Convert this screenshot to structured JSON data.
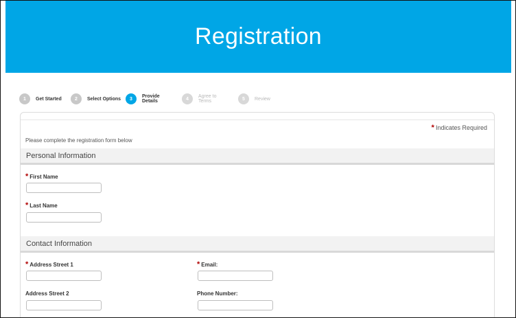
{
  "banner": {
    "title": "Registration"
  },
  "steps": [
    {
      "num": "1",
      "label": "Get Started",
      "state": "done"
    },
    {
      "num": "2",
      "label": "Select Options",
      "state": "done"
    },
    {
      "num": "3",
      "label": "Provide Details",
      "state": "active"
    },
    {
      "num": "4",
      "label": "Agree to Terms",
      "state": "future"
    },
    {
      "num": "5",
      "label": "Review",
      "state": "future"
    }
  ],
  "form": {
    "required_star": "*",
    "required_note": "Indicates Required",
    "intro": "Please complete the registration form below",
    "personal": {
      "header": "Personal Information",
      "first_name_label": "First Name",
      "last_name_label": "Last Name",
      "first_name_value": "",
      "last_name_value": ""
    },
    "contact": {
      "header": "Contact Information",
      "address1_label": "Address Street 1",
      "address2_label": "Address Street 2",
      "email_label": "Email:",
      "phone_label": "Phone Number:",
      "address1_value": "",
      "address2_value": "",
      "email_value": "",
      "phone_value": ""
    }
  },
  "colors": {
    "accent": "#00a6e6",
    "required": "#b00000"
  }
}
